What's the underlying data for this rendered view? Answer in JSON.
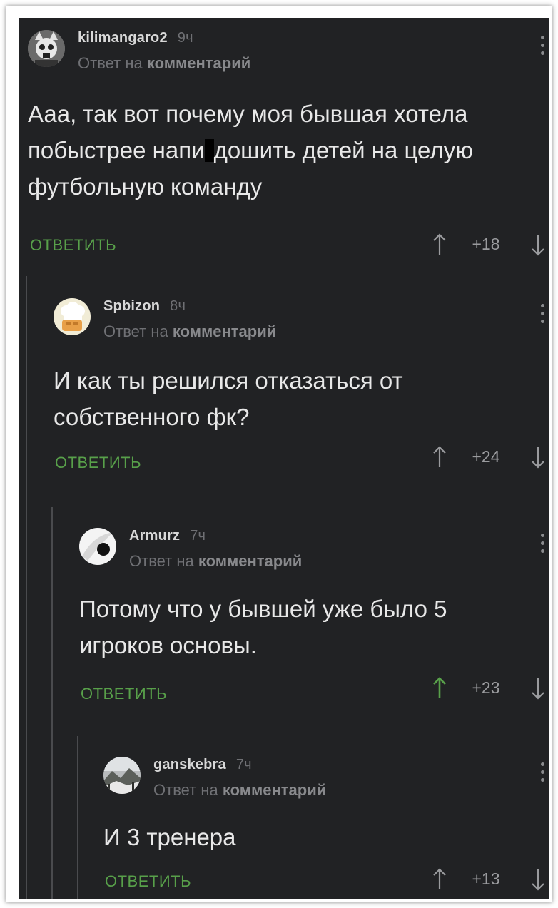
{
  "reply_to_prefix": "Ответ на",
  "reply_to_target": "комментарий",
  "reply_label": "ОТВЕТИТЬ",
  "colors": {
    "background": "#212224",
    "accent_green": "#58a04a",
    "text": "#e8e8e8",
    "muted": "#6f7074"
  },
  "comments": [
    {
      "author": "kilimangaro2",
      "time": "9ч",
      "avatar_icon": "wolf-skull-avatar",
      "text_before": "Ааа, так вот почему моя бывшая хотела побыстрее напи",
      "text_after": "дошить детей на целую футбольную команду",
      "score": "+18",
      "upvoted": false
    },
    {
      "author": "Spbizon",
      "time": "8ч",
      "avatar_icon": "chef-hat-avatar",
      "text": "И как ты решился отказаться от собственного фк?",
      "score": "+24",
      "upvoted": false
    },
    {
      "author": "Armurz",
      "time": "7ч",
      "avatar_icon": "white-feather-avatar",
      "text": "Потому что у бывшей уже было 5 игроков основы.",
      "score": "+23",
      "upvoted": true
    },
    {
      "author": "ganskebra",
      "time": "7ч",
      "avatar_icon": "snowy-landscape-avatar",
      "text": "И 3 тренера",
      "score": "+13",
      "upvoted": false
    }
  ]
}
